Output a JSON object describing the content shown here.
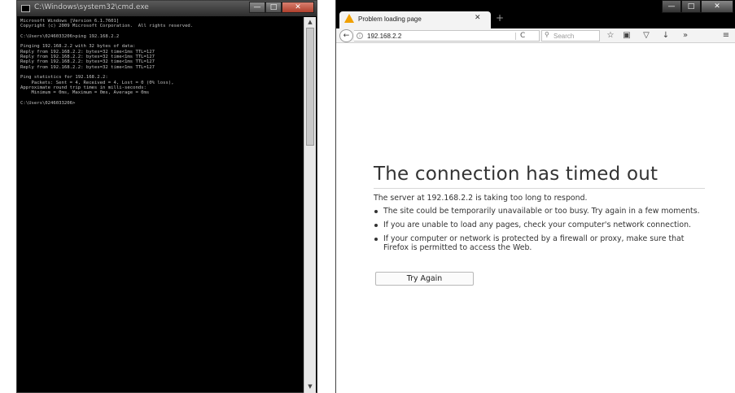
{
  "cmd": {
    "title": "C:\\Windows\\system32\\cmd.exe",
    "lines": [
      "Microsoft Windows [Version 6.1.7601]",
      "Copyright (c) 2009 Microsoft Corporation.  All rights reserved.",
      "",
      "C:\\Users\\0246033206>ping 192.168.2.2",
      "",
      "Pinging 192.168.2.2 with 32 bytes of data:",
      "Reply from 192.168.2.2: bytes=32 time<1ms TTL=127",
      "Reply from 192.168.2.2: bytes=32 time<1ms TTL=127",
      "Reply from 192.168.2.2: bytes=32 time<1ms TTL=127",
      "Reply from 192.168.2.2: bytes=32 time<1ms TTL=127",
      "",
      "Ping statistics for 192.168.2.2:",
      "    Packets: Sent = 4, Received = 4, Lost = 0 (0% loss),",
      "Approximate round trip times in milli-seconds:",
      "    Minimum = 0ms, Maximum = 0ms, Average = 0ms",
      "",
      "C:\\Users\\0246033206>"
    ],
    "controls": {
      "minimize": "—",
      "maximize": "□",
      "close": "✕"
    }
  },
  "firefox": {
    "tab": {
      "title": "Problem loading page",
      "close": "✕",
      "icon": "warning-icon"
    },
    "new_tab": "+",
    "window_controls": {
      "minimize": "—",
      "maximize": "□",
      "close": "✕"
    },
    "navbar": {
      "back": "←",
      "url": "192.168.2.2",
      "reload": "C",
      "search_placeholder": "Search",
      "icons": [
        "bookmark-star-icon",
        "reading-list-icon",
        "pocket-icon",
        "download-icon",
        "overflow-icon",
        "menu-icon"
      ],
      "icon_glyphs": [
        "☆",
        "▣",
        "▽",
        "↓",
        "»",
        "≡"
      ]
    },
    "error": {
      "title": "The connection has timed out",
      "description": "The server at 192.168.2.2 is taking too long to respond.",
      "items": [
        "The site could be temporarily unavailable or too busy. Try again in a few moments.",
        "If you are unable to load any pages, check your computer's network connection.",
        "If your computer or network is protected by a firewall or proxy, make sure that Firefox is permitted to access the Web."
      ],
      "button": "Try Again"
    }
  }
}
